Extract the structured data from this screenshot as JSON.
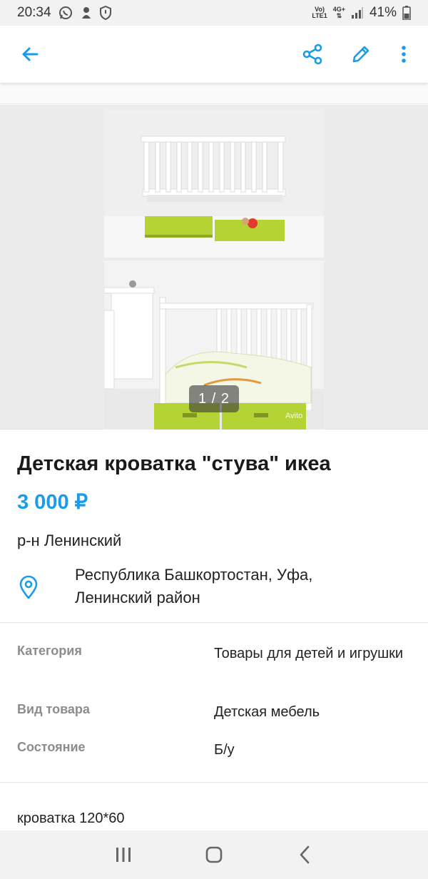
{
  "status_bar": {
    "time": "20:34",
    "signal_top": "Vo)",
    "signal_bottom": "LTE1",
    "network_top": "4G+",
    "battery": "41%"
  },
  "app_bar": {
    "back_icon": "arrow-left-icon",
    "share_icon": "share-icon",
    "edit_icon": "pencil-icon",
    "more_icon": "more-vertical-icon"
  },
  "gallery": {
    "counter": "1 / 2",
    "watermark": "Avito"
  },
  "listing": {
    "title": "Детская кроватка \"стува\" икеа",
    "price": "3 000 ₽",
    "district": "р-н Ленинский",
    "address_line1": "Республика Башкортостан, Уфа,",
    "address_line2": "Ленинский район"
  },
  "params": [
    {
      "label": "Категория",
      "value": "Товары для детей и игрушки"
    },
    {
      "label": "Вид товара",
      "value": "Детская мебель"
    },
    {
      "label": "Состояние",
      "value": "Б/у"
    }
  ],
  "description": "кроватка 120*60",
  "colors": {
    "accent": "#1a9cea",
    "drawer_green": "#b5d334"
  }
}
